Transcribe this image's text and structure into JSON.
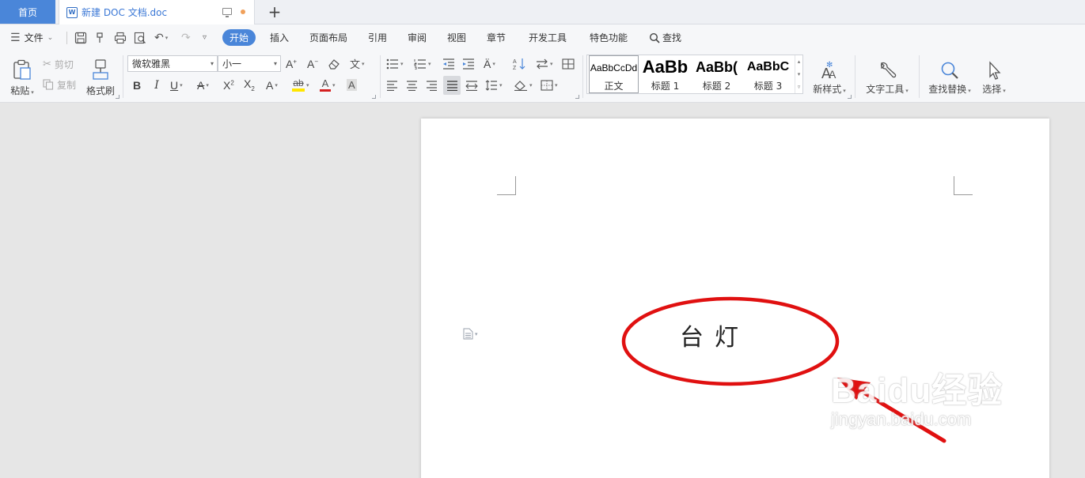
{
  "tabs": {
    "home_label": "首页",
    "doc_title": "新建 DOC 文档.doc",
    "doc_icon_letter": "W"
  },
  "menu": {
    "file_label": "文件",
    "items": [
      "开始",
      "插入",
      "页面布局",
      "引用",
      "审阅",
      "视图",
      "章节",
      "开发工具",
      "特色功能"
    ],
    "search_label": "查找"
  },
  "ribbon": {
    "paste_label": "粘贴",
    "cut_label": "剪切",
    "copy_label": "复制",
    "format_painter_label": "格式刷",
    "font_name": "微软雅黑",
    "font_size": "小一",
    "styles": [
      {
        "sample": "AaBbCcDd",
        "name": "正文"
      },
      {
        "sample": "AaBb",
        "name": "标题 1"
      },
      {
        "sample": "AaBb(",
        "name": "标题 2"
      },
      {
        "sample": "AaBbC",
        "name": "标题 3"
      }
    ],
    "new_style_label": "新样式",
    "text_tools_label": "文字工具",
    "find_replace_label": "查找替换",
    "select_label": "选择"
  },
  "document": {
    "body_text": "台灯"
  },
  "annotation": {
    "color": "#e01010"
  },
  "watermark": {
    "main": "Baidu经验",
    "sub": "jingyan.baidu.com"
  },
  "colors": {
    "accent": "#4a86d9",
    "tab_text": "#3b78d6",
    "highlight_yellow": "#ffe600",
    "font_color_red": "#d42020"
  }
}
